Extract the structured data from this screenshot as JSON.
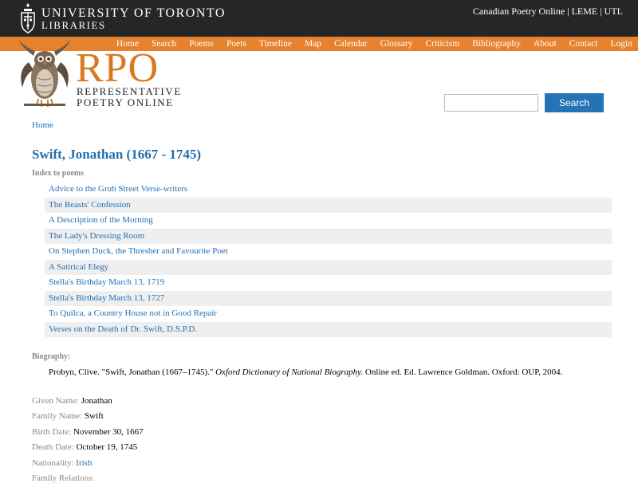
{
  "header": {
    "uoft_line1": "UNIVERSITY OF TORONTO",
    "uoft_line2": "LIBRARIES",
    "top_links": [
      "Canadian Poetry Online",
      "LEME",
      "UTL"
    ],
    "top_sep": "|",
    "rpo": "RPO",
    "rpo_sub1": "REPRESENTATIVE",
    "rpo_sub2": "POETRY ONLINE"
  },
  "nav": [
    "Home",
    "Search",
    "Poems",
    "Poets",
    "Timeline",
    "Map",
    "Calendar",
    "Glossary",
    "Criticism",
    "Bibliography",
    "About",
    "Contact",
    "Login"
  ],
  "search": {
    "button": "Search",
    "placeholder": ""
  },
  "breadcrumb": "Home",
  "title": "Swift, Jonathan (1667 - 1745)",
  "index_label": "Index to poems",
  "poems": [
    "Advice to the Grub Street Verse-writers",
    "The Beasts' Confession",
    "A Description of the Morning",
    "The Lady's Dressing Room",
    "On Stephen Duck, the Thresher and Favourite Poet",
    "A Satirical Elegy",
    "Stella's Birthday March 13, 1719",
    "Stella's Birthday March 13, 1727",
    "To Quilca, a Country House not in Good Repair",
    "Verses on the Death of Dr. Swift, D.S.P.D."
  ],
  "biography": {
    "label": "Biography:",
    "pre": "Probyn, Clive. \"Swift, Jonathan (1667–1745).\"",
    "italic": "Oxford Dictionary of National Biography.",
    "post": "Online ed. Ed. Lawrence Goldman. Oxford: OUP, 2004."
  },
  "details": {
    "given_name_label": "Given Name:",
    "given_name": "Jonathan",
    "family_name_label": "Family Name:",
    "family_name": "Swift",
    "birth_label": "Birth Date:",
    "birth": "November 30, 1667",
    "death_label": "Death Date:",
    "death": "October 19, 1745",
    "nationality_label": "Nationality:",
    "nationality": "Irish",
    "relations_label": "Family Relations:"
  }
}
